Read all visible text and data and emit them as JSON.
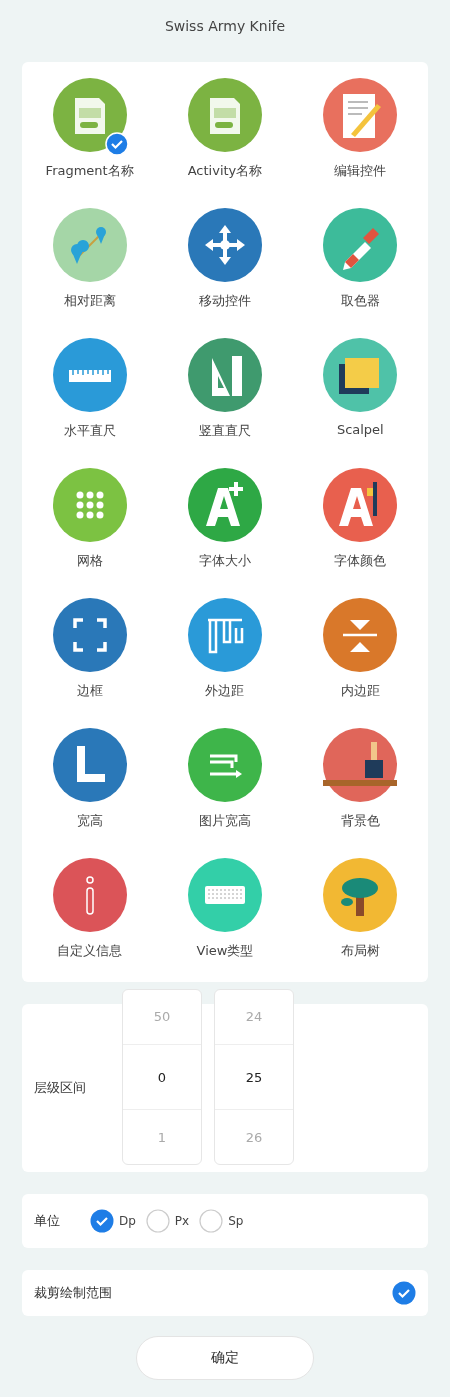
{
  "title": "Swiss Army Knife",
  "tools": [
    {
      "label": "Fragment名称",
      "color": "#7cb342",
      "selected": true
    },
    {
      "label": "Activity名称",
      "color": "#7cb342",
      "selected": false
    },
    {
      "label": "编辑控件",
      "color": "#e8705e",
      "selected": false
    },
    {
      "label": "相对距离",
      "color": "#a5d6a7",
      "selected": false
    },
    {
      "label": "移动控件",
      "color": "#2a78b8",
      "selected": false
    },
    {
      "label": "取色器",
      "color": "#3dbb9a",
      "selected": false
    },
    {
      "label": "水平直尺",
      "color": "#2a9ad8",
      "selected": false
    },
    {
      "label": "竖直直尺",
      "color": "#3f9a6e",
      "selected": false
    },
    {
      "label": "Scalpel",
      "color": "#4fc2a8",
      "selected": false
    },
    {
      "label": "网格",
      "color": "#7cc242",
      "selected": false
    },
    {
      "label": "字体大小",
      "color": "#2ea845",
      "selected": false
    },
    {
      "label": "字体颜色",
      "color": "#e8604e",
      "selected": false
    },
    {
      "label": "边框",
      "color": "#2a78b8",
      "selected": false
    },
    {
      "label": "外边距",
      "color": "#2a9ad8",
      "selected": false
    },
    {
      "label": "内边距",
      "color": "#d9782a",
      "selected": false
    },
    {
      "label": "宽高",
      "color": "#2a78b8",
      "selected": false
    },
    {
      "label": "图片宽高",
      "color": "#3eb54a",
      "selected": false
    },
    {
      "label": "背景色",
      "color": "#e0665a",
      "selected": false
    },
    {
      "label": "自定义信息",
      "color": "#db5458",
      "selected": false
    },
    {
      "label": "View类型",
      "color": "#33cfa8",
      "selected": false
    },
    {
      "label": "布局树",
      "color": "#f2b833",
      "selected": false
    }
  ],
  "level_range": {
    "label": "层级区间",
    "wheels": [
      {
        "above": "50",
        "value": "0",
        "below": "1"
      },
      {
        "above": "24",
        "value": "25",
        "below": "26"
      }
    ]
  },
  "unit": {
    "label": "单位",
    "options": [
      {
        "label": "Dp",
        "selected": true
      },
      {
        "label": "Px",
        "selected": false
      },
      {
        "label": "Sp",
        "selected": false
      }
    ]
  },
  "clip": {
    "label": "裁剪绘制范围",
    "checked": true
  },
  "confirm_button": "确定"
}
